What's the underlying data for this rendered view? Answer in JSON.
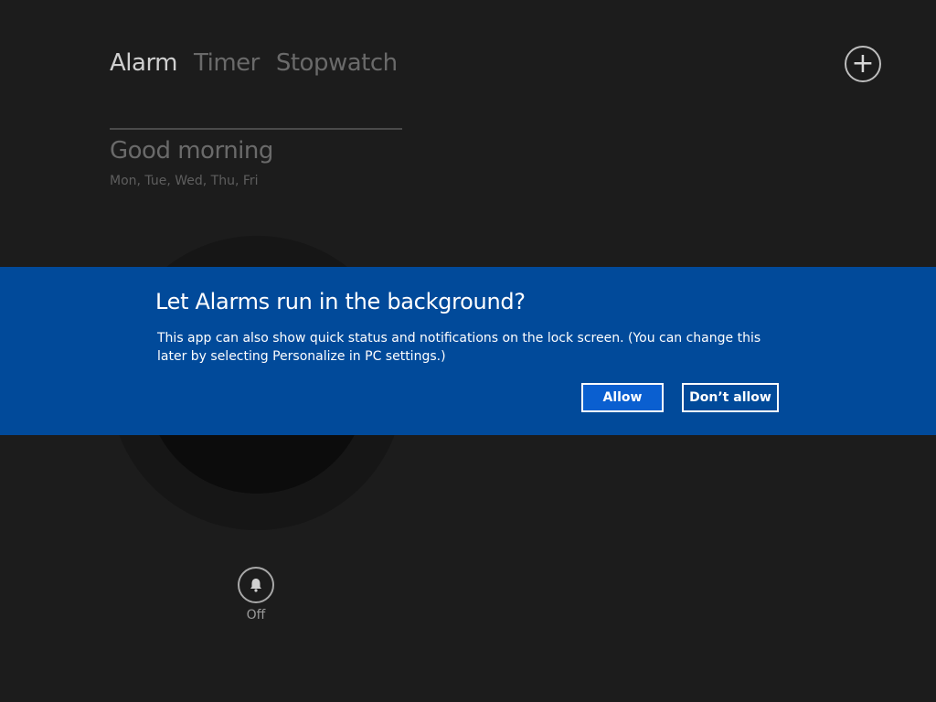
{
  "tabs": [
    {
      "label": "Alarm",
      "active": true
    },
    {
      "label": "Timer",
      "active": false
    },
    {
      "label": "Stopwatch",
      "active": false
    }
  ],
  "add_button": {
    "icon": "plus-icon",
    "symbol": "+"
  },
  "alarm": {
    "name": "Good morning",
    "days": "Mon, Tue, Wed, Thu, Fri",
    "status_label": "Off",
    "status_icon": "bell-icon"
  },
  "dialog": {
    "title": "Let Alarms run in the background?",
    "message": "This app can also show quick status and notifications on the lock screen. (You can change this later by selecting Personalize in PC settings.)",
    "allow_label": "Allow",
    "deny_label": "Don’t allow",
    "background_color": "#014a9a"
  },
  "colors": {
    "app_background": "#1c1c1c",
    "active_tab": "#cfcfcf",
    "inactive_tab": "#6a6a6a",
    "accent": "#014a9a"
  }
}
